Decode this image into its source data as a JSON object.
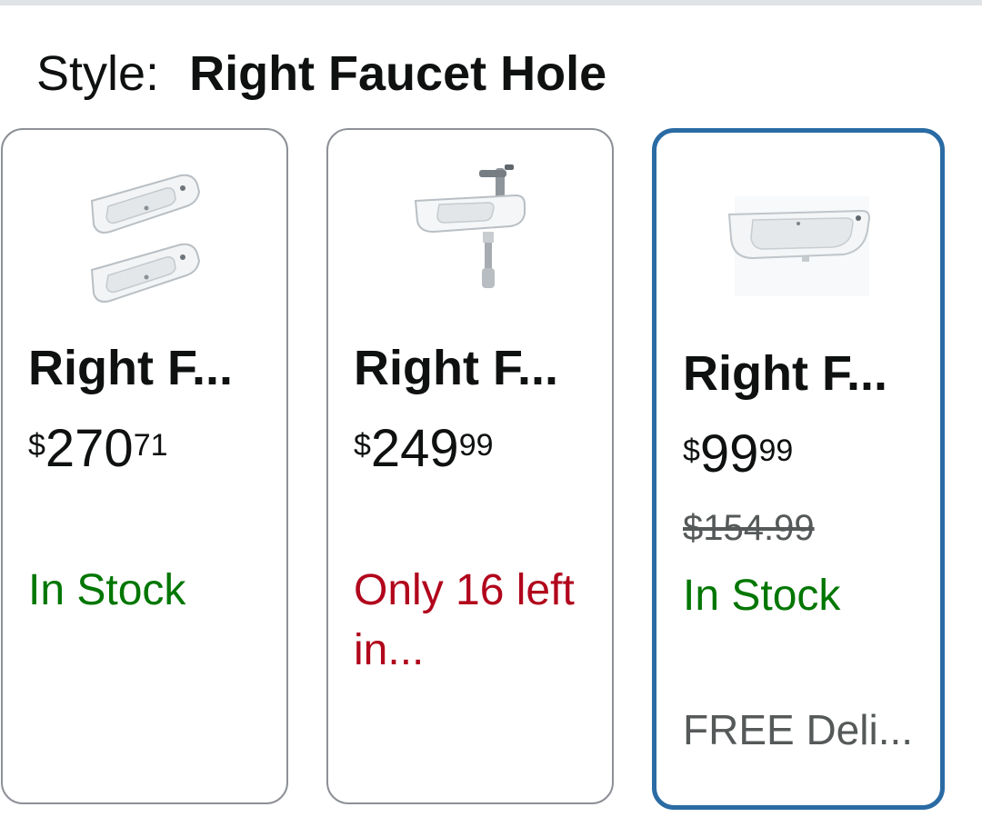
{
  "style_selector": {
    "label": "Style:",
    "selected_value": "Right Faucet Hole"
  },
  "options": [
    {
      "title": "Right F...",
      "price_symbol": "$",
      "price_whole": "270",
      "price_fraction": "71",
      "availability": "In Stock",
      "availability_color": "#007600",
      "selected": false,
      "image_icon": "double-sink-image"
    },
    {
      "title": "Right F...",
      "price_symbol": "$",
      "price_whole": "249",
      "price_fraction": "99",
      "availability": "Only 16 left in...",
      "availability_color": "#b1061c",
      "selected": false,
      "image_icon": "sink-with-faucet-image"
    },
    {
      "title": "Right F...",
      "price_symbol": "$",
      "price_whole": "99",
      "price_fraction": "99",
      "list_price": "$154.99",
      "availability": "In Stock",
      "availability_color": "#007600",
      "delivery": "FREE Deli...",
      "selected": true,
      "selected_border_color": "#2a6ba4",
      "image_icon": "single-sink-image"
    }
  ]
}
